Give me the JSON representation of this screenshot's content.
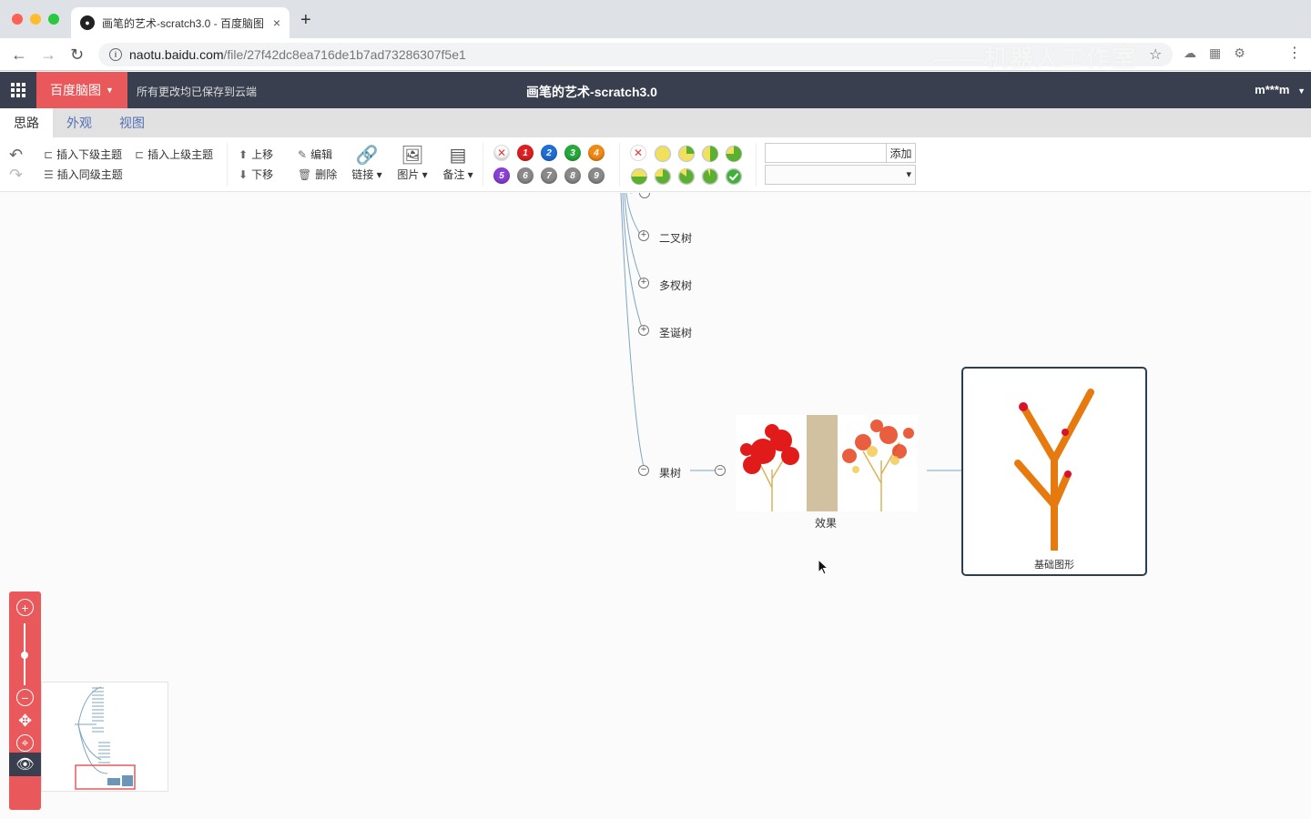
{
  "browser": {
    "tab_title": "画笔的艺术-scratch3.0 - 百度脑图",
    "tab_close": "×",
    "new_tab": "+",
    "url_host": "naotu.baidu.com",
    "url_path": "/file/27f42dc8ea716de1b7ad73286307f5e1",
    "watermark": "——机器人工作室"
  },
  "app": {
    "brand_label": "百度脑图",
    "save_status": "所有更改均已保存到云端",
    "doc_title": "画笔的艺术-scratch3.0",
    "user": "m***m"
  },
  "menu_tabs": [
    {
      "label": "思路"
    },
    {
      "label": "外观"
    },
    {
      "label": "视图"
    }
  ],
  "toolbar": {
    "insert_child": "插入下级主题",
    "insert_parent": "插入上级主题",
    "insert_sibling": "插入同级主题",
    "move_up": "上移",
    "move_down": "下移",
    "edit": "编辑",
    "delete": "删除",
    "link": "链接",
    "image": "图片",
    "note": "备注",
    "resource_add": "添加",
    "priorities": [
      "1",
      "2",
      "3",
      "4",
      "5",
      "6",
      "7",
      "8",
      "9"
    ],
    "priority_colors": [
      "#e02020",
      "#1f6fd6",
      "#27a93b",
      "#f28a15",
      "#8a3fd6",
      "#8a8a8a",
      "#8a8a8a",
      "#8a8a8a",
      "#8a8a8a"
    ]
  },
  "mindmap": {
    "nodes": [
      {
        "label": "二叉树"
      },
      {
        "label": "多杈树"
      },
      {
        "label": "圣诞树"
      },
      {
        "label": "果树"
      }
    ],
    "image_node_caption": "效果",
    "selected_node_caption": "基础图形",
    "edge_color": "#7fa6c2"
  }
}
